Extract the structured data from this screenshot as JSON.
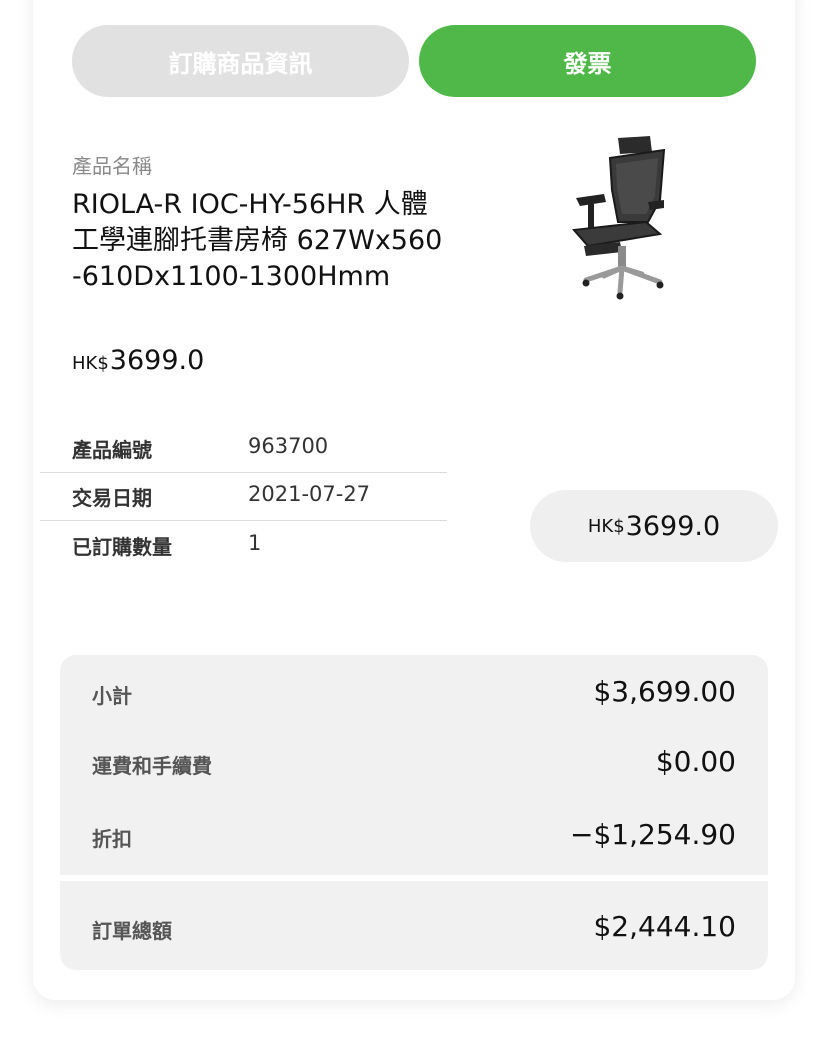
{
  "tabs": {
    "info_label": "訂購商品資訊",
    "invoice_label": "發票"
  },
  "product": {
    "name_label": "產品名稱",
    "name": "RIOLA-R IOC-HY-56HR 人體工學連腳托書房椅 627Wx560-610Dx1100-1300Hmm",
    "currency": "HK$",
    "price": "3699.0",
    "image_icon": "office-chair-icon"
  },
  "details": [
    {
      "label": "產品編號",
      "value": "963700"
    },
    {
      "label": "交易日期",
      "value": "2021-07-27"
    },
    {
      "label": "已訂購數量",
      "value": "1"
    }
  ],
  "line_total": {
    "currency": "HK$",
    "amount": "3699.0"
  },
  "summary": {
    "subtotal_label": "小計",
    "subtotal_value": "$3,699.00",
    "shipping_label": "運費和手續費",
    "shipping_value": "$0.00",
    "discount_label": "折扣",
    "discount_value": "−$1,254.90",
    "total_label": "訂單總額",
    "total_value": "$2,444.10"
  },
  "colors": {
    "accent": "#50b848",
    "inactive_tab": "#e1e1e1",
    "summary_bg": "#f1f1f1"
  }
}
